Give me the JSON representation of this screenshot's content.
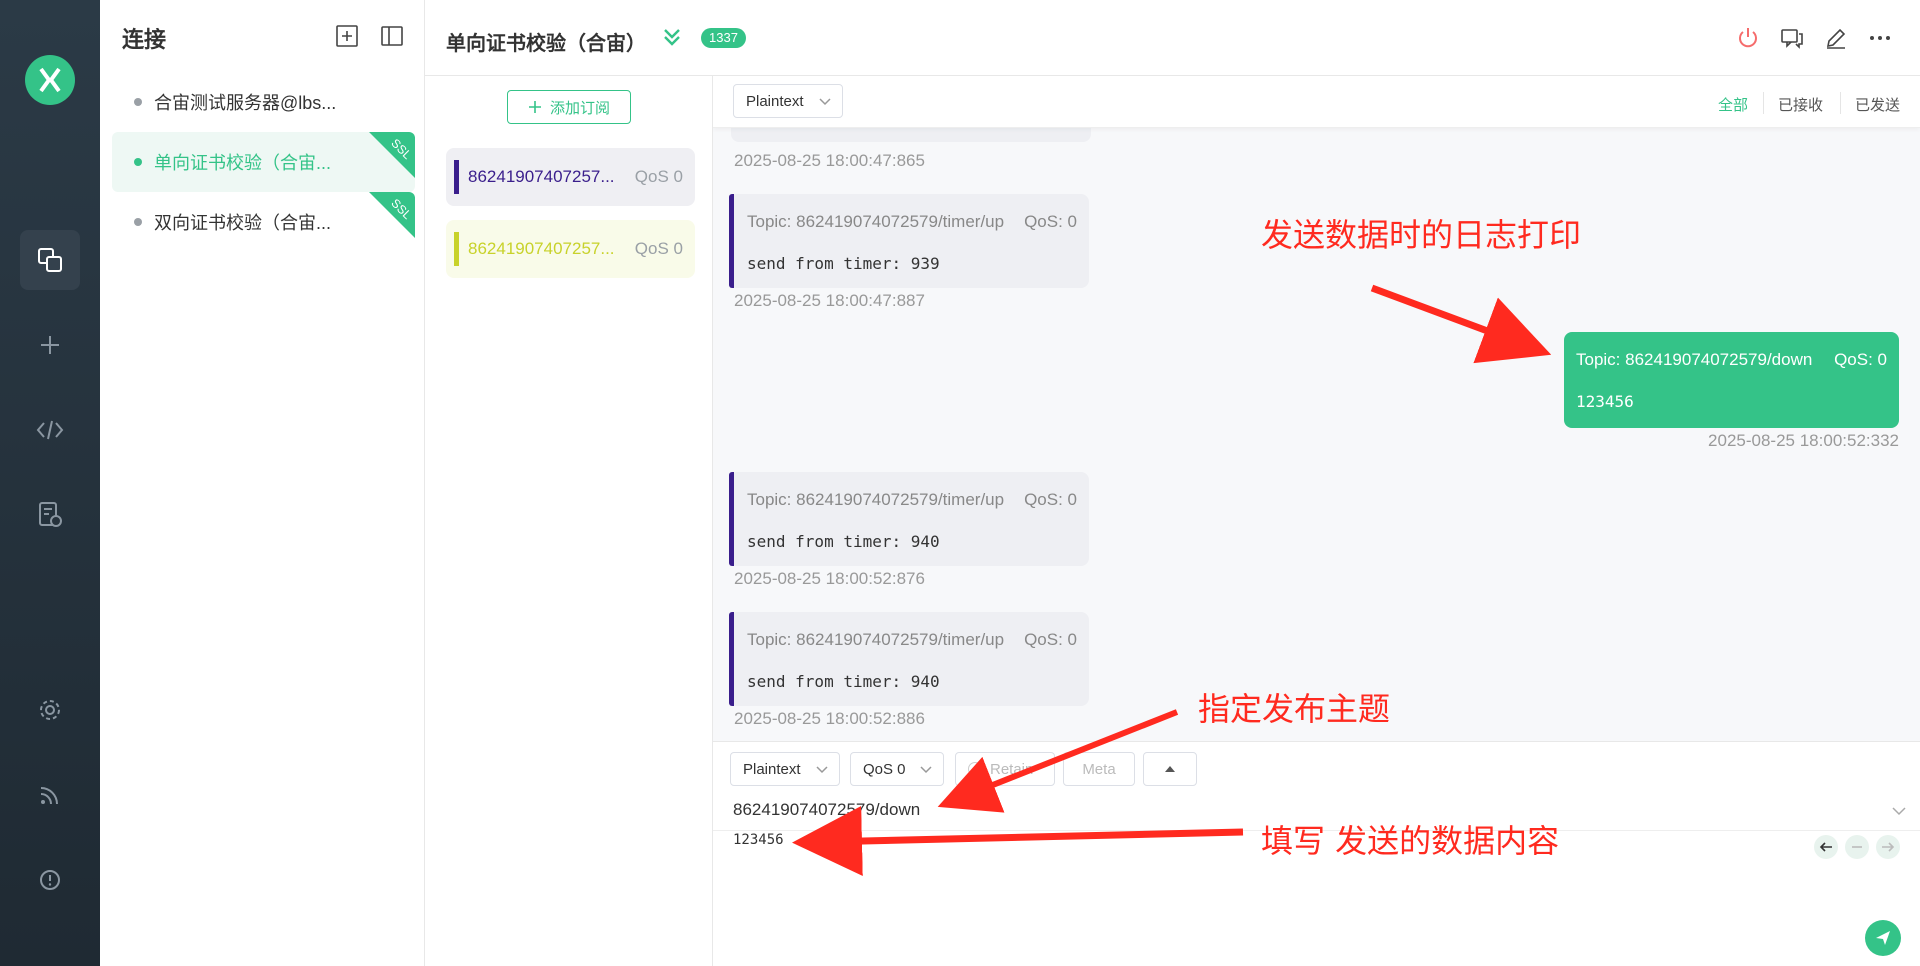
{
  "sidebar_conn": {
    "title": "连接",
    "items": [
      {
        "label": "合宙测试服务器@lbs...",
        "ssl": false
      },
      {
        "label": "单向证书校验（合宙...",
        "ssl": true
      },
      {
        "label": "双向证书校验（合宙...",
        "ssl": true
      }
    ],
    "ssl_label": "SSL"
  },
  "header": {
    "title": "单向证书校验（合宙）",
    "count": "1337"
  },
  "subscriptions": {
    "add_label": "添加订阅",
    "items": [
      {
        "topic": "86241907407257...",
        "qos": "QoS 0",
        "color": "#3a1e8c"
      },
      {
        "topic": "86241907407257...",
        "qos": "QoS 0",
        "color": "#c8d22a"
      }
    ]
  },
  "messages": {
    "format": "Plaintext",
    "filters": [
      "全部",
      "已接收",
      "已发送"
    ],
    "list": [
      {
        "kind": "time_only",
        "time": "2025-08-25 18:00:47:865"
      },
      {
        "kind": "received",
        "topic": "Topic: 862419074072579/timer/up",
        "qos": "QoS: 0",
        "payload": "send from timer: 939",
        "time": "2025-08-25 18:00:47:887"
      },
      {
        "kind": "sent",
        "topic": "Topic: 862419074072579/down",
        "qos": "QoS: 0",
        "payload": "123456",
        "time": "2025-08-25 18:00:52:332"
      },
      {
        "kind": "received",
        "topic": "Topic: 862419074072579/timer/up",
        "qos": "QoS: 0",
        "payload": "send from timer: 940",
        "time": "2025-08-25 18:00:52:876"
      },
      {
        "kind": "received",
        "topic": "Topic: 862419074072579/timer/up",
        "qos": "QoS: 0",
        "payload": "send from timer: 940",
        "time": "2025-08-25 18:00:52:886"
      }
    ]
  },
  "composer": {
    "format": "Plaintext",
    "qos": "QoS 0",
    "retain": "Retain",
    "meta": "Meta",
    "topic": "862419074072579/down",
    "payload": "123456"
  },
  "annotations": {
    "log": "发送数据时的日志打印",
    "topic": "指定发布主题",
    "payload": "填写 发送的数据内容"
  },
  "colors": {
    "accent": "#34c388",
    "annotation": "#ff2a1f"
  }
}
